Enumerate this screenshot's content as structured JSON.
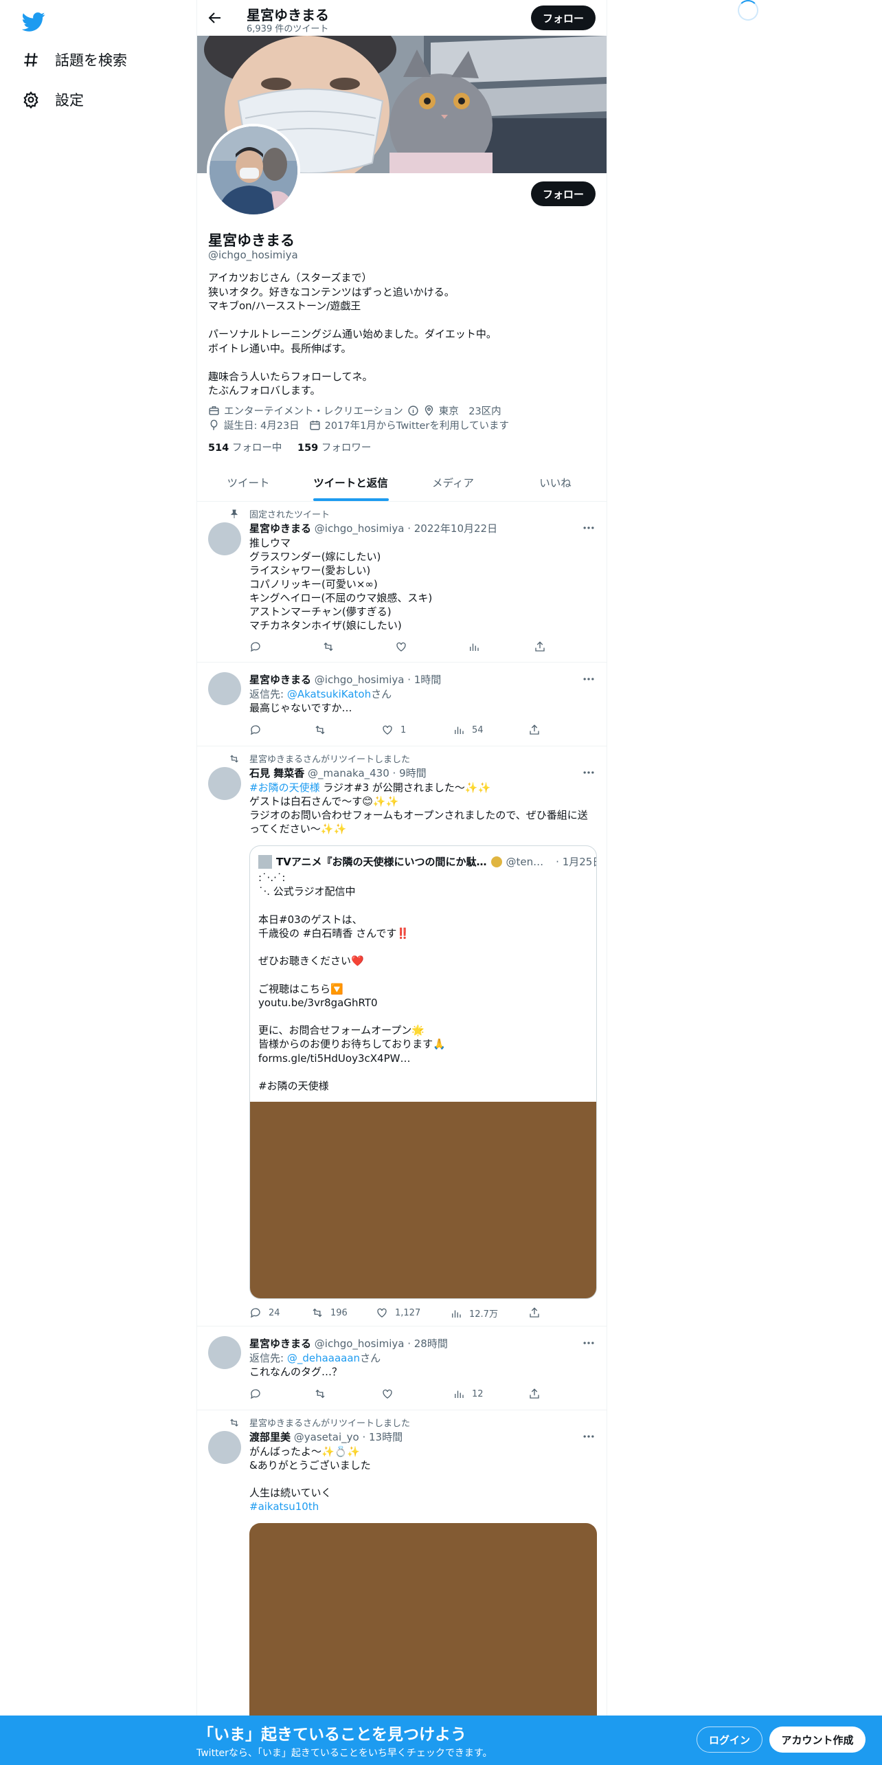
{
  "nav": {
    "explore_label": "話題を検索",
    "settings_label": "設定"
  },
  "header": {
    "name": "星宮ゆきまる",
    "tweet_count": "6,939 件のツイート",
    "follow_label": "フォロー"
  },
  "profile": {
    "name": "星宮ゆきまる",
    "handle": "@ichgo_hosimiya",
    "follow_label": "フォロー",
    "bio": "アイカツおじさん（スターズまで）\n狭いオタク。好きなコンテンツはずっと追いかける。\nマキブon/ハースストーン/遊戯王\n\nパーソナルトレーニングジム通い始めました。ダイエット中。\nボイトレ通い中。長所伸ばす。\n\n趣味合う人いたらフォローしてネ。\nたぶんフォロバします。",
    "category": "エンターテイメント・レクリエーション",
    "location": "東京　23区内",
    "birthday": "誕生日: 4月23日",
    "joined": "2017年1月からTwitterを利用しています",
    "following_count": "514",
    "following_label": "フォロー中",
    "followers_count": "159",
    "followers_label": "フォロワー"
  },
  "tabs": [
    {
      "label": "ツイート"
    },
    {
      "label": "ツイートと返信"
    },
    {
      "label": "メディア"
    },
    {
      "label": "いいね"
    }
  ],
  "tweets": [
    {
      "social": "固定されたツイート",
      "name": "星宮ゆきまる",
      "meta": "@ichgo_hosimiya · 2022年10月22日",
      "text": "推しウマ\nグラスワンダー(嫁にしたい)\nライスシャワー(愛おしい)\nコパノリッキー(可愛い×∞)\nキングヘイロー(不屈のウマ娘感、スキ)\nアストンマーチャン(儚すぎる)\nマチカネタンホイザ(娘にしたい)"
    },
    {
      "name": "星宮ゆきまる",
      "meta": "@ichgo_hosimiya · 1時間",
      "reply_to_prefix": "返信先: ",
      "reply_to_handle": "@AkatsukiKatoh",
      "reply_to_suffix": "さん",
      "text": "最高じゃないですか…",
      "likes": "1",
      "views": "54"
    },
    {
      "social": "星宮ゆきまるさんがリツイートしました",
      "name": "石見 舞菜香",
      "meta": "@_manaka_430 · 9時間",
      "hashtag": "#お隣の天使様",
      "text_after_tag": " ラジオ#3 が公開されました〜✨✨",
      "text": "ゲストは白石さんで〜す😊✨✨\nラジオのお問い合わせフォームもオープンされましたので、ぜひ番組に送ってください〜✨✨",
      "quote": {
        "name": "TVアニメ『お隣の天使様にいつの間にか駄…",
        "handle": "@ten…",
        "date": "· 1月25日",
        "text": "  :˙·.·˙:\n  ˙·. 公式ラジオ配信中\n\n本日#03のゲストは、\n千歳役の #白石晴香 さんです‼️\n\nぜひお聴きください❤️\n\nご視聴はこちら🔽\nyoutu.be/3vr8gaGhRT0\n\n更に、お問合せフォームオープン🌟\n皆様からのお便りお待ちしております🙏\nforms.gle/ti5HdUoy3cX4PW…\n\n#お隣の天使様"
      },
      "replies": "24",
      "retweets": "196",
      "likes": "1,127",
      "views": "12.7万"
    },
    {
      "name": "星宮ゆきまる",
      "meta": "@ichgo_hosimiya · 28時間",
      "reply_to_prefix": "返信先: ",
      "reply_to_handle": "@_dehaaaaan",
      "reply_to_suffix": "さん",
      "text": "これなんのタグ…？",
      "views": "12"
    },
    {
      "social": "星宮ゆきまるさんがリツイートしました",
      "name": "渡部里美",
      "meta": "@yasetai_yo · 13時間",
      "text": "がんばったよ～✨💍✨\n&ありがとうございました\n\n人生は続いていく",
      "hashtag": "#aikatsu10th"
    }
  ],
  "bottom_bar": {
    "title": "「いま」起きていることを見つけよう",
    "subtitle": "Twitterなら、「いま」起きていることをいち早くチェックできます。",
    "login_label": "ログイン",
    "signup_label": "アカウント作成"
  },
  "colors": {
    "accent": "#1d9bf0",
    "dark": "#0f1419",
    "muted": "#536471",
    "media": "#835b33"
  }
}
